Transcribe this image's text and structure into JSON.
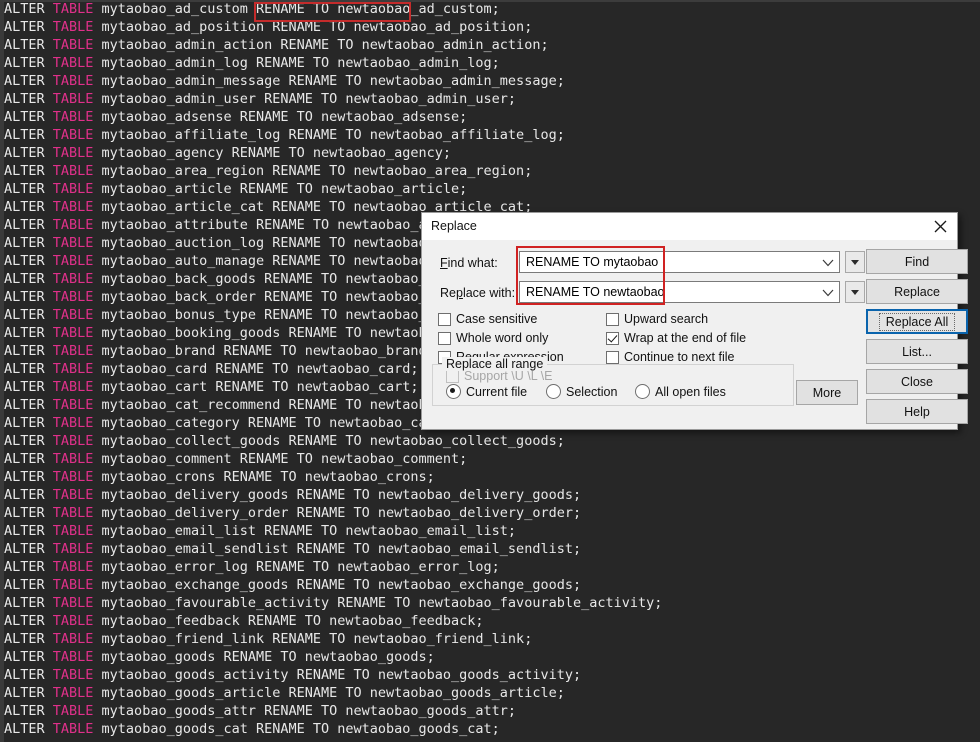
{
  "editor": {
    "keyword_alter": "ALTER",
    "keyword_table": "TABLE",
    "highlight_text": "RENAME TO newtaobao",
    "lines": [
      {
        "rest": " mytaobao_ad_custom RENAME TO newtaobao_ad_custom;"
      },
      {
        "rest": " mytaobao_ad_position RENAME TO newtaobao_ad_position;"
      },
      {
        "rest": " mytaobao_admin_action RENAME TO newtaobao_admin_action;"
      },
      {
        "rest": " mytaobao_admin_log RENAME TO newtaobao_admin_log;"
      },
      {
        "rest": " mytaobao_admin_message RENAME TO newtaobao_admin_message;"
      },
      {
        "rest": " mytaobao_admin_user RENAME TO newtaobao_admin_user;"
      },
      {
        "rest": " mytaobao_adsense RENAME TO newtaobao_adsense;"
      },
      {
        "rest": " mytaobao_affiliate_log RENAME TO newtaobao_affiliate_log;"
      },
      {
        "rest": " mytaobao_agency RENAME TO newtaobao_agency;"
      },
      {
        "rest": " mytaobao_area_region RENAME TO newtaobao_area_region;"
      },
      {
        "rest": " mytaobao_article RENAME TO newtaobao_article;"
      },
      {
        "rest": " mytaobao_article_cat RENAME TO newtaobao_article_cat;"
      },
      {
        "rest": " mytaobao_attribute RENAME TO newtaobao_attribute;"
      },
      {
        "rest": " mytaobao_auction_log RENAME TO newtaobao_auction_log;"
      },
      {
        "rest": " mytaobao_auto_manage RENAME TO newtaobao_auto_manage;"
      },
      {
        "rest": " mytaobao_back_goods RENAME TO newtaobao_back_goods;"
      },
      {
        "rest": " mytaobao_back_order RENAME TO newtaobao_back_order;"
      },
      {
        "rest": " mytaobao_bonus_type RENAME TO newtaobao_bonus_type;"
      },
      {
        "rest": " mytaobao_booking_goods RENAME TO newtaobao_booking_goods;"
      },
      {
        "rest": " mytaobao_brand RENAME TO newtaobao_brand;"
      },
      {
        "rest": " mytaobao_card RENAME TO newtaobao_card;"
      },
      {
        "rest": " mytaobao_cart RENAME TO newtaobao_cart;"
      },
      {
        "rest": " mytaobao_cat_recommend RENAME TO newtaobao_cat_recommend;"
      },
      {
        "rest": " mytaobao_category RENAME TO newtaobao_category;"
      },
      {
        "rest": " mytaobao_collect_goods RENAME TO newtaobao_collect_goods;"
      },
      {
        "rest": " mytaobao_comment RENAME TO newtaobao_comment;"
      },
      {
        "rest": " mytaobao_crons RENAME TO newtaobao_crons;"
      },
      {
        "rest": " mytaobao_delivery_goods RENAME TO newtaobao_delivery_goods;"
      },
      {
        "rest": " mytaobao_delivery_order RENAME TO newtaobao_delivery_order;"
      },
      {
        "rest": " mytaobao_email_list RENAME TO newtaobao_email_list;"
      },
      {
        "rest": " mytaobao_email_sendlist RENAME TO newtaobao_email_sendlist;"
      },
      {
        "rest": " mytaobao_error_log RENAME TO newtaobao_error_log;"
      },
      {
        "rest": " mytaobao_exchange_goods RENAME TO newtaobao_exchange_goods;"
      },
      {
        "rest": " mytaobao_favourable_activity RENAME TO newtaobao_favourable_activity;"
      },
      {
        "rest": " mytaobao_feedback RENAME TO newtaobao_feedback;"
      },
      {
        "rest": " mytaobao_friend_link RENAME TO newtaobao_friend_link;"
      },
      {
        "rest": " mytaobao_goods RENAME TO newtaobao_goods;"
      },
      {
        "rest": " mytaobao_goods_activity RENAME TO newtaobao_goods_activity;"
      },
      {
        "rest": " mytaobao_goods_article RENAME TO newtaobao_goods_article;"
      },
      {
        "rest": " mytaobao_goods_attr RENAME TO newtaobao_goods_attr;"
      },
      {
        "rest": " mytaobao_goods_cat RENAME TO newtaobao_goods_cat;"
      }
    ]
  },
  "dialog": {
    "title": "Replace",
    "close_icon": "close-icon",
    "find_label": "Find what:",
    "find_value": "RENAME TO mytaobao",
    "replace_label": "Replace with:",
    "replace_value": "RENAME TO newtaobao",
    "checkboxes_left": [
      {
        "label": "Case sensitive",
        "checked": false,
        "disabled": false
      },
      {
        "label": "Whole word only",
        "checked": false,
        "disabled": false
      },
      {
        "label": "Regular expression",
        "checked": false,
        "disabled": false
      },
      {
        "label": "Support \\U \\L \\E",
        "checked": false,
        "disabled": true
      }
    ],
    "checkboxes_right": [
      {
        "label": "Upward search",
        "checked": false,
        "disabled": false
      },
      {
        "label": "Wrap at the end of file",
        "checked": true,
        "disabled": false
      },
      {
        "label": "Continue to next file",
        "checked": false,
        "disabled": false
      }
    ],
    "range_group_label": "Replace all range",
    "range_options": [
      {
        "label": "Current file",
        "selected": true
      },
      {
        "label": "Selection",
        "selected": false
      },
      {
        "label": "All open files",
        "selected": false
      }
    ],
    "buttons": [
      {
        "label": "Find",
        "focused": false
      },
      {
        "label": "Replace",
        "focused": false
      },
      {
        "label": "Replace All",
        "focused": true
      },
      {
        "label": "List...",
        "focused": false
      },
      {
        "label": "Close",
        "focused": false
      },
      {
        "label": "Help",
        "focused": false
      }
    ],
    "more_button": "More"
  },
  "colors": {
    "editor_bg": "#272727",
    "editor_text": "#e8e8e8",
    "keyword_pink": "#e0308a",
    "highlight_red": "#c42b2b",
    "focus_blue": "#0a64ad",
    "dialog_bg": "#f0f0f0"
  }
}
